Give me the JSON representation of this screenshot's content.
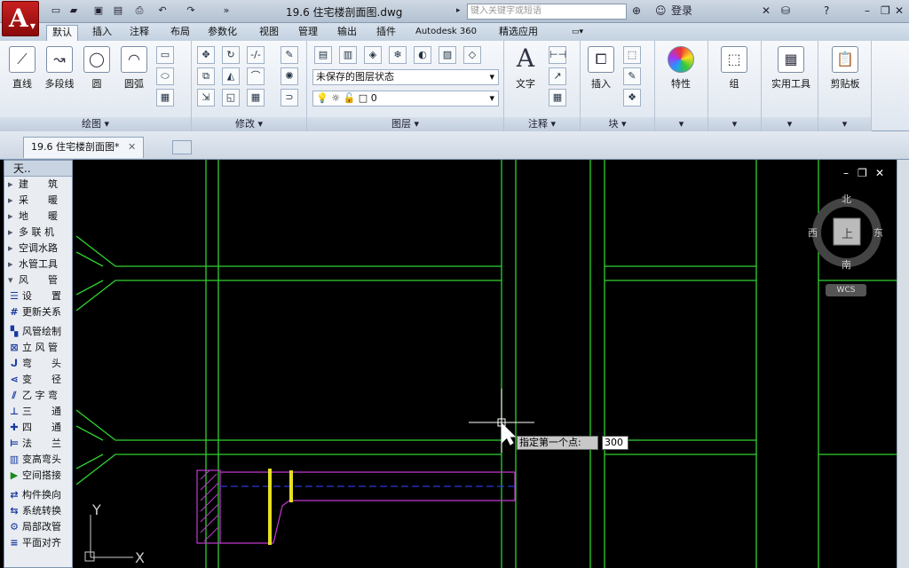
{
  "app": {
    "logo_letter": "A",
    "title": "19.6   住宅楼剖面图.dwg",
    "search_placeholder": "键入关键字或短语",
    "login": "登录"
  },
  "tabs": [
    "默认",
    "插入",
    "注释",
    "布局",
    "参数化",
    "视图",
    "管理",
    "输出",
    "插件",
    "Autodesk 360",
    "精选应用"
  ],
  "draw_panel": {
    "title": "绘图",
    "tools": [
      "直线",
      "多段线",
      "圆",
      "圆弧"
    ]
  },
  "modify_panel": {
    "title": "修改"
  },
  "layer_panel": {
    "title": "图层",
    "layer_state": "未保存的图层状态",
    "current_layer": "0"
  },
  "annotation_panel": {
    "title": "注释",
    "text_label": "文字"
  },
  "block_panel": {
    "title": "块",
    "insert_label": "插入"
  },
  "properties_label": "特性",
  "groups_label": "组",
  "utilities_label": "实用工具",
  "clipboard_label": "剪贴板",
  "doc_tab": {
    "label": "19.6   住宅楼剖面图*"
  },
  "tool_palette": {
    "header": "天..",
    "categories": [
      "建　　筑",
      "采　　暖",
      "地　　暖",
      "多 联 机",
      "空调水路",
      "水管工具",
      "风　　管"
    ],
    "tools": [
      "设　　置",
      "更新关系",
      "风管绘制",
      "立 风 管",
      "弯　　头",
      "变　　径",
      "乙 字 弯",
      "三　　通",
      "四　　通",
      "法　　兰",
      "变高弯头",
      "空间搭接",
      "构件换向",
      "系统转换",
      "局部改管",
      "平面对齐"
    ]
  },
  "viewcube": {
    "north": "北",
    "south": "南",
    "east": "东",
    "west": "西",
    "center": "上",
    "wcs": "WCS"
  },
  "command": {
    "prompt": "指定第一个点:",
    "input_value": "300"
  },
  "ucs": {
    "x": "X",
    "y": "Y"
  },
  "colors": {
    "line": "#2fd12f",
    "magenta": "#c13ad0",
    "yellow": "#e6e020",
    "blue": "#2a3ad8"
  }
}
